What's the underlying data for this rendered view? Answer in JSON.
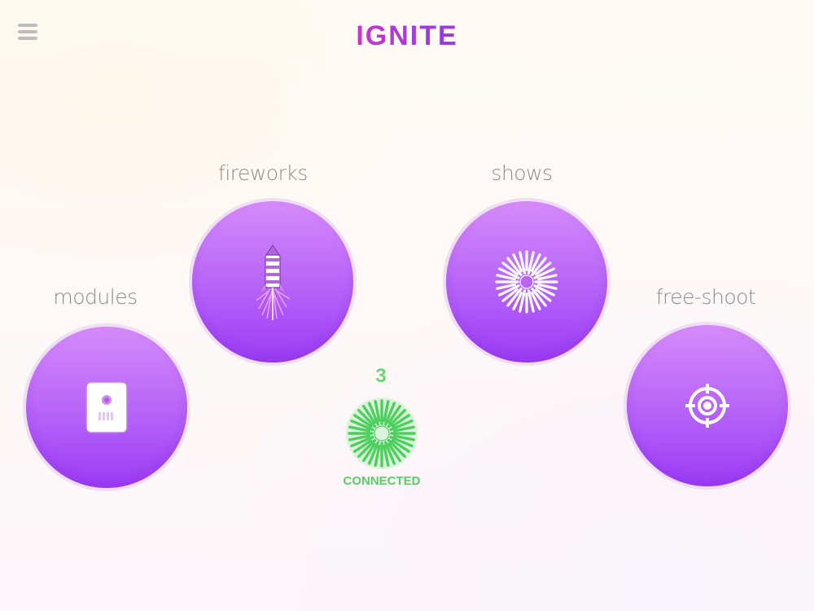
{
  "header": {
    "logo_text": "IGNITE",
    "menu_icon": "hamburger-menu-icon"
  },
  "tiles": {
    "modules": {
      "label": "modules",
      "icon": "module-device-icon"
    },
    "fireworks": {
      "label": "fireworks",
      "icon": "rocket-icon"
    },
    "shows": {
      "label": "shows",
      "icon": "firework-burst-icon"
    },
    "free_shoot": {
      "label": "free-shoot",
      "icon": "crosshair-icon"
    }
  },
  "connection": {
    "count": "3",
    "status": "CONNECTED",
    "icon": "connected-burst-icon"
  },
  "colors": {
    "brand": "#a63ee0",
    "tile": "#b562f8",
    "connected": "#5ccb68",
    "label": "#8c8c8c"
  }
}
